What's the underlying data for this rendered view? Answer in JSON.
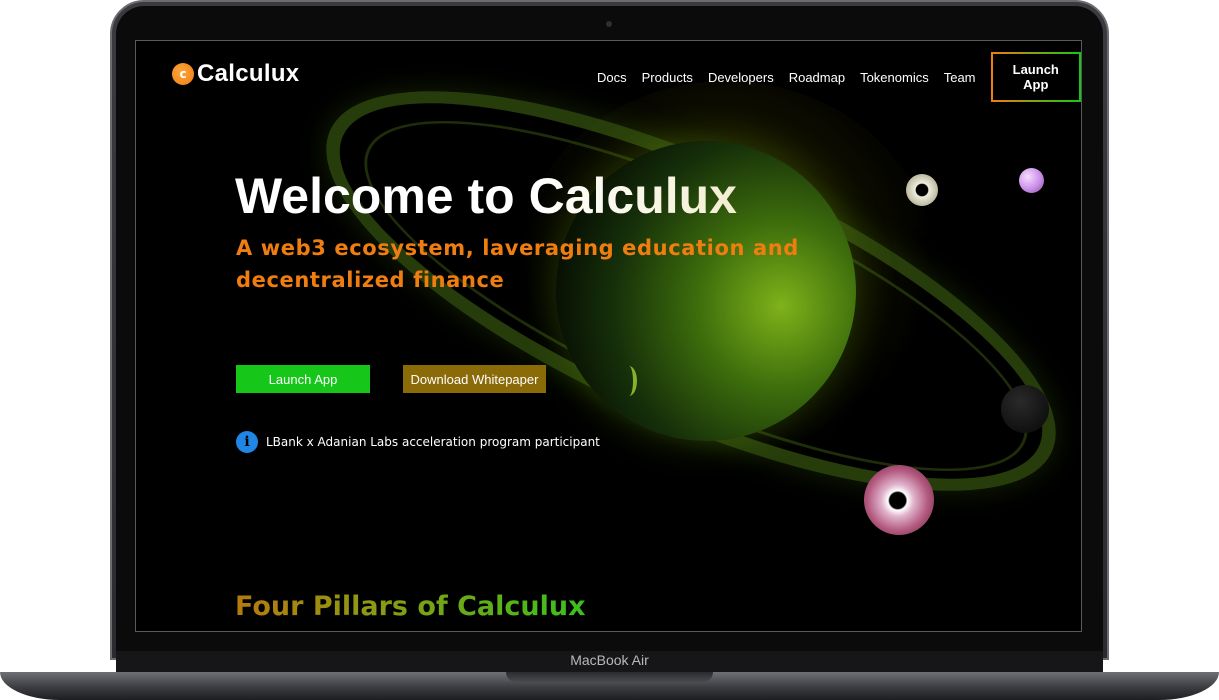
{
  "device": {
    "label": "MacBook Air"
  },
  "site": {
    "logo_mark": "c",
    "logo_text": "Calculux"
  },
  "nav": {
    "items": [
      "Docs",
      "Products",
      "Developers",
      "Roadmap",
      "Tokenomics",
      "Team"
    ],
    "launch_label": "Launch App"
  },
  "hero": {
    "title": "Welcome to Calculux",
    "subtitle": "A web3 ecosystem, laveraging education and decentralized finance",
    "launch_button": "Launch App",
    "whitepaper_button": "Download Whitepaper",
    "notice_icon": "i",
    "notice_text": "LBank x Adanian Labs acceleration program participant"
  },
  "section": {
    "title": "Four Pillars of Calculux"
  },
  "colors": {
    "accent_orange": "#f07d10",
    "accent_green": "#16c618",
    "button_brown": "#8b6a08",
    "info_blue": "#1f86e6"
  },
  "icons": {
    "logo": "calculux-logo-icon",
    "info": "info-icon"
  }
}
